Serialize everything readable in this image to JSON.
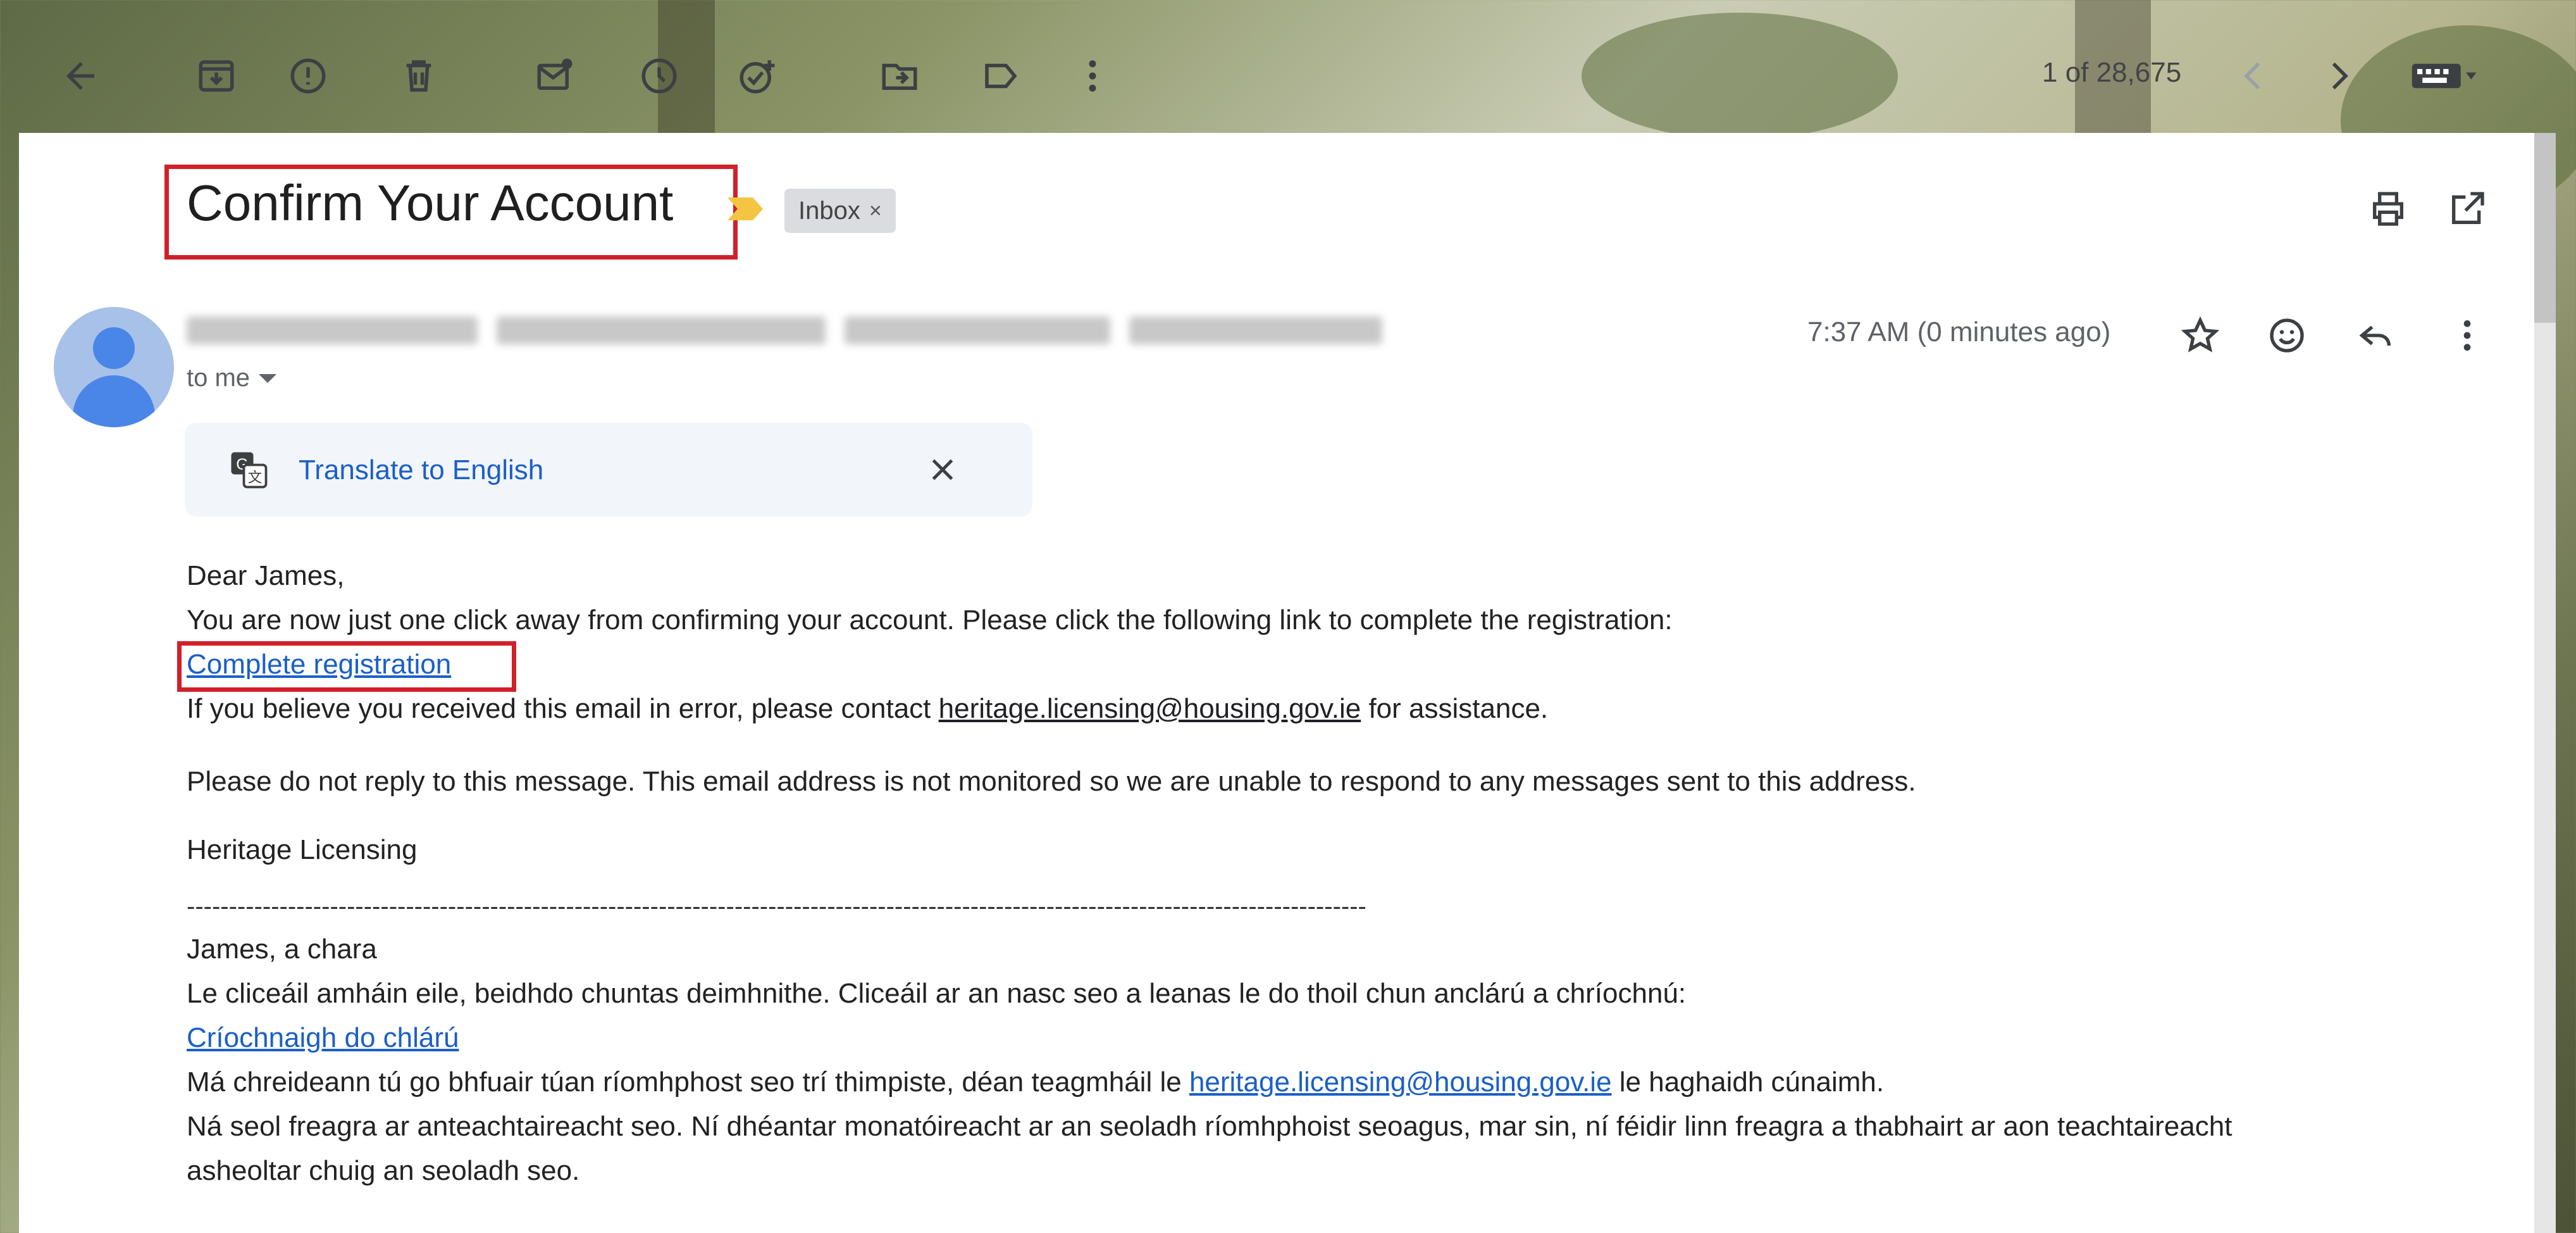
{
  "toolbar": {
    "icons": [
      "back-arrow-icon",
      "archive-icon",
      "report-spam-icon",
      "delete-icon",
      "mark-unread-icon",
      "snooze-icon",
      "add-to-tasks-icon",
      "move-to-icon",
      "label-icon",
      "more-vertical-icon"
    ],
    "pagination": "1 of 28,675",
    "nav_icons": [
      "chevron-left-icon",
      "chevron-right-icon",
      "keyboard-icon"
    ]
  },
  "email": {
    "subject": "Confirm Your Account",
    "label_chip": "Inbox",
    "label_remove": "×",
    "recipient": "to me",
    "timestamp": "7:37 AM (0 minutes ago)",
    "translate_label": "Translate to English",
    "translate_close": "✕",
    "body": {
      "greeting": "Dear James,",
      "line1": "You are now just one click away from confirming your account. Please click the following link to complete the registration:",
      "link_complete": "Complete registration",
      "line2_prefix": "If you believe you received this email in error, please contact ",
      "email_link": "heritage.licensing@housing.gov.ie",
      "line2_suffix": " for assistance.",
      "line3": "Please do not reply to this message. This email address is not monitored so we are unable to respond to any messages sent to this address.",
      "signature": "Heritage Licensing",
      "divider": "--------------------------------------------------------------------------------------------------------------------------------------------",
      "irish_greeting": "James, a chara",
      "irish_line1": "Le cliceáil amháin eile, beidhdo chuntas deimhnithe. Cliceáil ar an nasc seo a leanas le do thoil chun anclárú a chríochnú:",
      "irish_link": "Críochnaigh do chlárú",
      "irish_line2_prefix": "Má chreideann tú go bhfuair túan ríomhphost seo trí thimpiste, déan teagmháil le ",
      "irish_email_link": "heritage.licensing@housing.gov.ie",
      "irish_line2_suffix": " le haghaidh cúnaimh.",
      "irish_line3a": "Ná seol freagra ar anteachtaireacht seo. Ní dhéantar monatóireacht ar an seoladh ríomhphoist seoagus, mar sin, ní féidir linn freagra a thabhairt ar aon teachtaireacht",
      "irish_line3b": "asheoltar chuig an seoladh seo."
    }
  },
  "colors": {
    "link": "#1a5fc7",
    "highlight_box": "#d1202a",
    "importance_marker": "#f4c542"
  }
}
